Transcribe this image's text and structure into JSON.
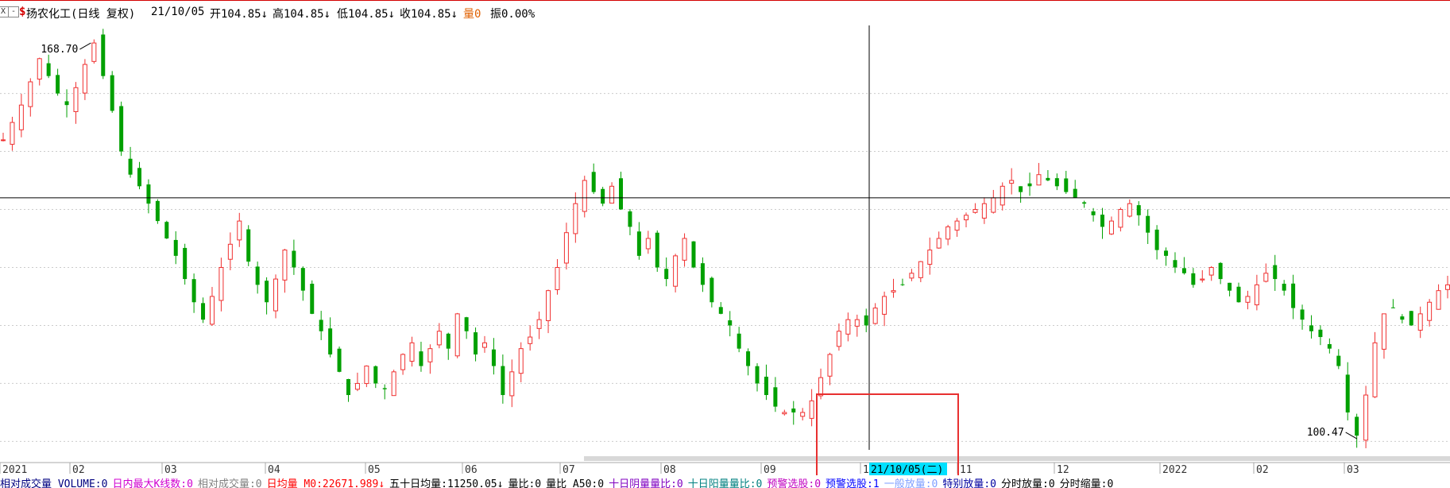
{
  "header": {
    "close_box": "X",
    "minus_box": "-",
    "dollar_icon": "$",
    "title": "扬农化工(日线 复权)",
    "date": "21/10/05",
    "open_label": "开104.85↓",
    "high_label": "高104.85↓",
    "low_label": "低104.85↓",
    "close_label": "收104.85↓",
    "volume_label": "量0",
    "amplitude_label": "振0.00%"
  },
  "chart_data": {
    "type": "candlestick",
    "title": "扬农化工(日线 复权)",
    "x_tick_labels": [
      "2021",
      "02",
      "03",
      "04",
      "05",
      "06",
      "07",
      "08",
      "09",
      "10",
      "11",
      "12",
      "2022",
      "02",
      "03"
    ],
    "y_gridlines": [
      160,
      150,
      140,
      130,
      120,
      110,
      100
    ],
    "ylim": [
      98,
      172
    ],
    "max_annotation": {
      "label": "168.70",
      "value": 168.7
    },
    "min_annotation": {
      "label": "100.47",
      "value": 100.47
    },
    "crosshair": {
      "date_label": "21/10/05(二)",
      "price": 142.0
    },
    "colors": {
      "up": "#f03030",
      "down": "#00a000",
      "grid": "#cccccc",
      "crosshair": "#000000",
      "highlight_box": "#e83030",
      "date_bg": "#00e0ff"
    },
    "trend_path": [
      152,
      155,
      158,
      162,
      166,
      163,
      160,
      158,
      161,
      165,
      168.7,
      163,
      157,
      150,
      146,
      144,
      141,
      138,
      135,
      132,
      128,
      124,
      121,
      125,
      130,
      134,
      138,
      131,
      127,
      124,
      128,
      133,
      130,
      126,
      122,
      119,
      115,
      112,
      108,
      110,
      113,
      110,
      109,
      112,
      115,
      117,
      113,
      116,
      119,
      116,
      122,
      119,
      115,
      117,
      113,
      108,
      112,
      116,
      118,
      121,
      126,
      130,
      136,
      141,
      145,
      143,
      141,
      144,
      140,
      137,
      132,
      135,
      130,
      128,
      132,
      135,
      130,
      127,
      124,
      122,
      120,
      116,
      113,
      110,
      108,
      106,
      105,
      105,
      105,
      107,
      111,
      115,
      119,
      121,
      121,
      120,
      123,
      125,
      126,
      127,
      129,
      131,
      133,
      135,
      137,
      138,
      139,
      140,
      141,
      142,
      144,
      145,
      143,
      144,
      146,
      145,
      144,
      143,
      142,
      141,
      139,
      137,
      138,
      140,
      141,
      139,
      136,
      133,
      132,
      130,
      129,
      127,
      128,
      130,
      128,
      126,
      124,
      125,
      127,
      129,
      128,
      126,
      123,
      121,
      119,
      118,
      116,
      113,
      105,
      101,
      108,
      117,
      122,
      123,
      121,
      120,
      122,
      124,
      126,
      127
    ]
  },
  "footer": {
    "items": [
      {
        "text": "相对成交量 VOLUME:0",
        "color": "#000080"
      },
      {
        "text": "日内最大K线数:0",
        "color": "#d000d0"
      },
      {
        "text": "相对成交量:0",
        "color": "#808080"
      },
      {
        "text": "日均量 M0:22671.989↓",
        "color": "#ff0000"
      },
      {
        "text": "五十日均量:11250.05↓",
        "color": "#000000"
      },
      {
        "text": "量比:0",
        "color": "#000000"
      },
      {
        "text": "量比 A50:0",
        "color": "#000000"
      },
      {
        "text": "十日阴量量比:0",
        "color": "#8000c0"
      },
      {
        "text": "十日阳量量比:0",
        "color": "#008080"
      },
      {
        "text": "预警选股:0",
        "color": "#c000c0"
      },
      {
        "text": "预警选股:1",
        "color": "#0000ff"
      },
      {
        "text": "一般放量:0",
        "color": "#80a0ff"
      },
      {
        "text": "特别放量:0",
        "color": "#0000a0"
      },
      {
        "text": "分时放量:0",
        "color": "#000000"
      },
      {
        "text": "分时缩量:0",
        "color": "#000000"
      }
    ]
  }
}
